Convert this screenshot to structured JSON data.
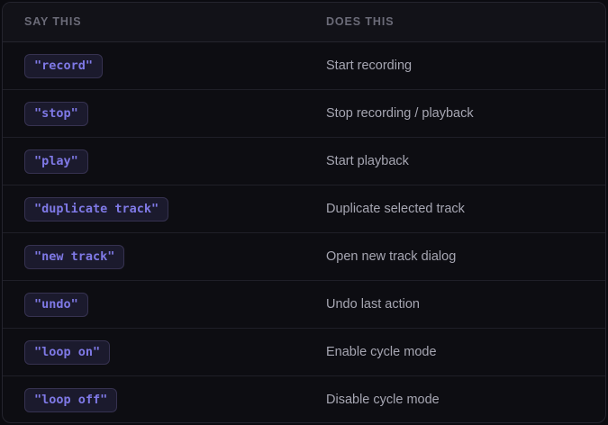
{
  "header": {
    "say_label": "SAY THIS",
    "does_label": "DOES THIS"
  },
  "commands": [
    {
      "phrase": "\"record\"",
      "action": "Start recording"
    },
    {
      "phrase": "\"stop\"",
      "action": "Stop recording / playback"
    },
    {
      "phrase": "\"play\"",
      "action": "Start playback"
    },
    {
      "phrase": "\"duplicate track\"",
      "action": "Duplicate selected track"
    },
    {
      "phrase": "\"new track\"",
      "action": "Open new track dialog"
    },
    {
      "phrase": "\"undo\"",
      "action": "Undo last action"
    },
    {
      "phrase": "\"loop on\"",
      "action": "Enable cycle mode"
    },
    {
      "phrase": "\"loop off\"",
      "action": "Disable cycle mode"
    }
  ],
  "colors": {
    "background": "#0b0b10",
    "chip_text": "#7f79e6",
    "chip_bg": "#1b1a2d",
    "description_text": "#a6a6b2",
    "header_text": "#6b6b78"
  }
}
